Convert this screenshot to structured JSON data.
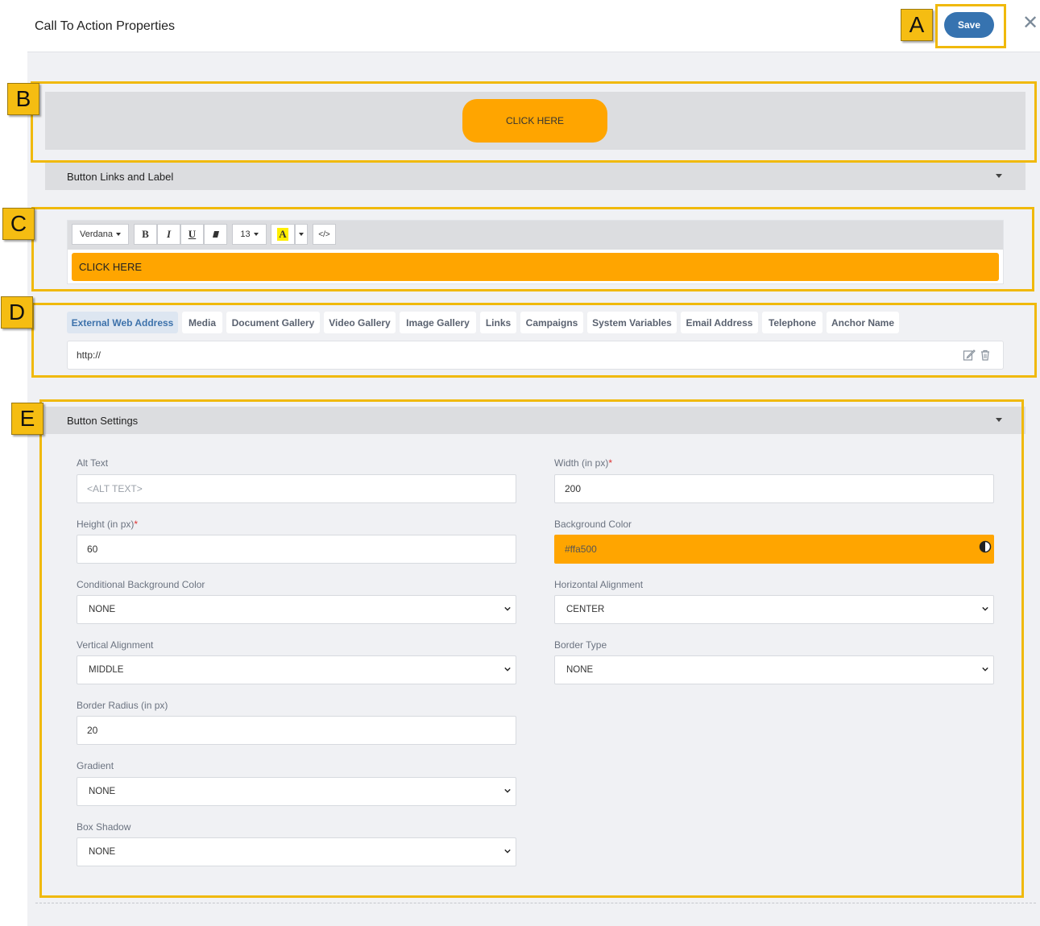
{
  "header": {
    "title": "Call To Action Properties",
    "save_label": "Save",
    "close_icon": "close-icon"
  },
  "preview": {
    "button_label": "CLICK HERE",
    "button_color": "#ffa500"
  },
  "links_section": {
    "title": "Button Links and Label"
  },
  "editor": {
    "font": "Verdana",
    "bold": "B",
    "italic": "I",
    "underline": "U",
    "font_size": "13",
    "color_letter": "A",
    "code": "</>",
    "content": "CLICK HERE"
  },
  "link_tabs": [
    "External Web Address",
    "Media",
    "Document Gallery",
    "Video Gallery",
    "Image Gallery",
    "Links",
    "Campaigns",
    "System Variables",
    "Email Address",
    "Telephone",
    "Anchor Name"
  ],
  "active_tab": "External Web Address",
  "url": {
    "value": "http://"
  },
  "settings": {
    "title": "Button Settings",
    "alt_text": {
      "label": "Alt Text",
      "placeholder": "<ALT TEXT>"
    },
    "width": {
      "label": "Width (in px)",
      "required": "*",
      "value": "200"
    },
    "height": {
      "label": "Height (in px)",
      "required": "*",
      "value": "60"
    },
    "background_color": {
      "label": "Background Color",
      "value": "#ffa500",
      "display": "#ffa500"
    },
    "conditional_bg": {
      "label": "Conditional Background Color",
      "value": "NONE"
    },
    "horizontal_alignment": {
      "label": "Horizontal Alignment",
      "value": "CENTER"
    },
    "vertical_alignment": {
      "label": "Vertical Alignment",
      "value": "MIDDLE"
    },
    "border_type": {
      "label": "Border Type",
      "value": "NONE"
    },
    "border_radius": {
      "label": "Border Radius (in px)",
      "value": "20"
    },
    "gradient": {
      "label": "Gradient",
      "value": "NONE"
    },
    "box_shadow": {
      "label": "Box Shadow",
      "value": "NONE"
    }
  },
  "callouts": {
    "a": "A",
    "b": "B",
    "c": "C",
    "d": "D",
    "e": "E"
  },
  "colors": {
    "accent": "#3673b0",
    "callout": "#f0b90b",
    "orange": "#ffa500"
  }
}
